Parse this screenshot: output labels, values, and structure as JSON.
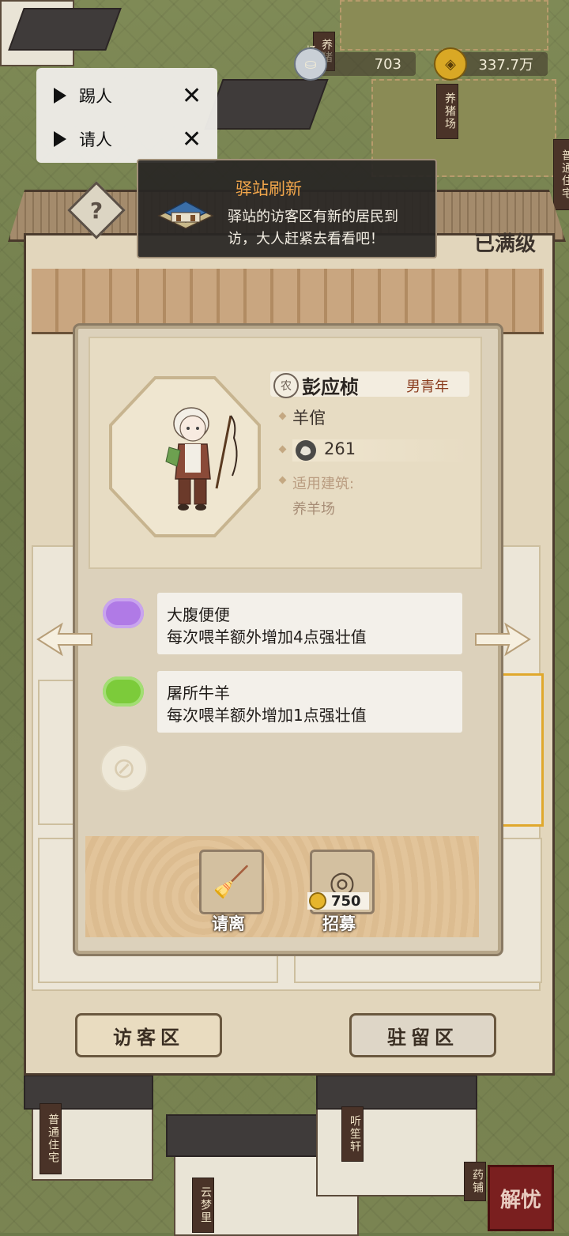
{
  "resources": {
    "silver": {
      "value": "703",
      "icon": "silver-ingot-icon"
    },
    "copper": {
      "value": "337.7万",
      "icon": "copper-coin-icon"
    }
  },
  "debug_menu": {
    "items": [
      {
        "label": "踢人"
      },
      {
        "label": "请人"
      }
    ]
  },
  "notification": {
    "title": "驿站刷新",
    "message": "驿站的访客区有新的居民到访，大人赶紧去看看吧！"
  },
  "station": {
    "max_level_label": "已满级",
    "help_label": "?",
    "tabs": [
      {
        "label": "访客区"
      },
      {
        "label": "驻留区"
      }
    ]
  },
  "resident": {
    "badge": "农",
    "name": "彭应桢",
    "gender_age": "男青年",
    "profession": "羊倌",
    "strength": "261",
    "building_label": "适用建筑:",
    "building": "养羊场",
    "traits": [
      {
        "name": "大腹便便",
        "desc": "每次喂羊额外增加4点强壮值",
        "color": "#b07ae6"
      },
      {
        "name": "屠所牛羊",
        "desc": "每次喂羊额外增加1点强壮值",
        "color": "#7ccb3a"
      }
    ],
    "actions": {
      "dismiss": {
        "label": "请离"
      },
      "recruit": {
        "label": "招募",
        "cost": "750"
      }
    }
  },
  "map": {
    "signs": [
      "养猪场",
      "养猪场",
      "普通住宅",
      "普通住宅",
      "云梦里",
      "听笙轩",
      "药铺"
    ],
    "seal": "解忧"
  }
}
